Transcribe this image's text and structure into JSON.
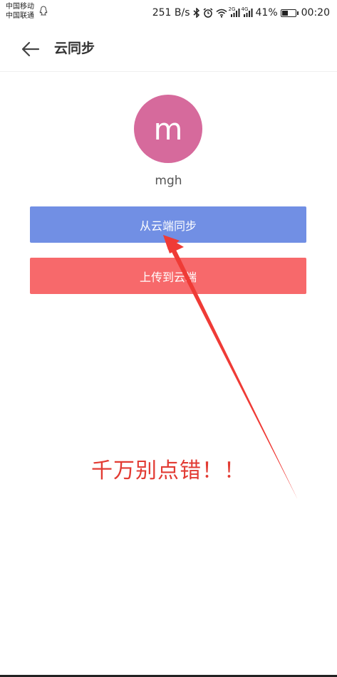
{
  "status_bar": {
    "carrier_1": "中国移动",
    "carrier_2": "中国联通",
    "network_speed": "251 B/s",
    "signal_1_label": "2G",
    "signal_2_label": "4G",
    "battery_percent": "41%",
    "time": "00:20",
    "icons": [
      "qq-icon",
      "bluetooth-icon",
      "alarm-icon",
      "wifi-icon",
      "signal-icon",
      "battery-icon"
    ]
  },
  "header": {
    "title": "云同步",
    "back_icon": "arrow-left-icon"
  },
  "profile": {
    "avatar_letter": "m",
    "username": "mgh",
    "avatar_color": "#d66a9c"
  },
  "actions": {
    "sync_from_cloud": "从云端同步",
    "upload_to_cloud": "上传到云端",
    "sync_color": "#718fe4",
    "upload_color": "#f7696b"
  },
  "annotation": {
    "text": "千万别点错！！",
    "color": "#e23b33"
  }
}
